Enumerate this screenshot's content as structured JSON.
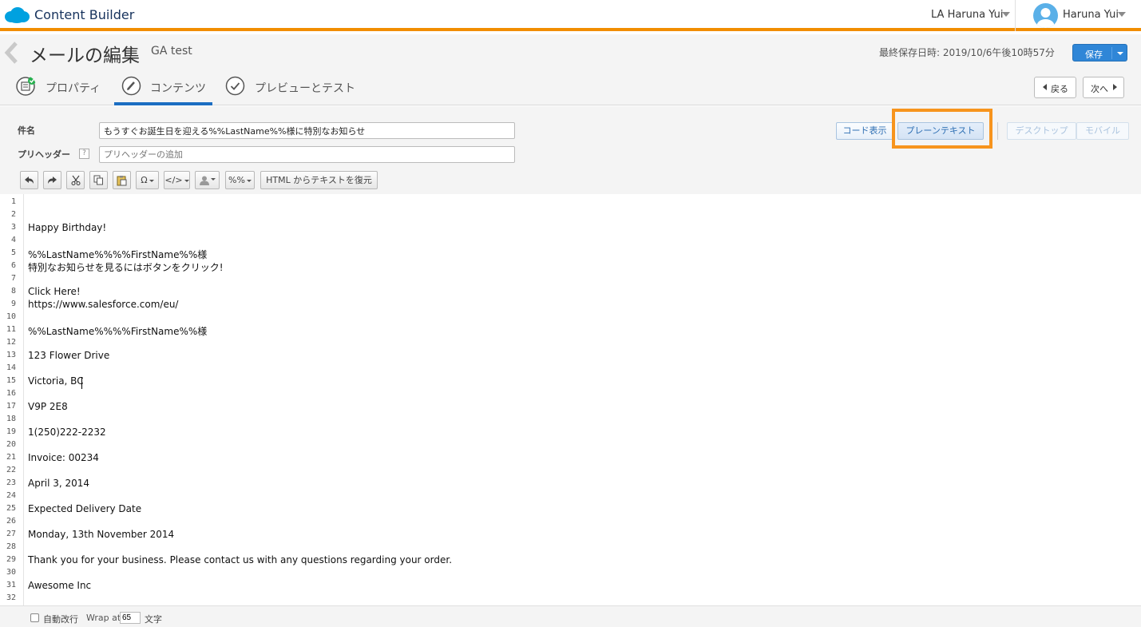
{
  "topbar": {
    "app_title": "Content Builder",
    "account": "LA Haruna Yui",
    "user": "Haruna Yui"
  },
  "header": {
    "title": "メールの編集",
    "email_name": "GA test",
    "saved_at": "最終保存日時: 2019/10/6午後10時57分",
    "save_label": "保存",
    "tabs": [
      {
        "label": "プロパティ",
        "icon": "properties-check-icon"
      },
      {
        "label": "コンテンツ",
        "icon": "pencil-icon",
        "active": true
      },
      {
        "label": "プレビューとテスト",
        "icon": "checkmark-icon"
      }
    ],
    "prev_label": "戻る",
    "next_label": "次へ"
  },
  "form": {
    "subject_label": "件名",
    "subject_value": "もうすぐお誕生日を迎える%%LastName%%様に特別なお知らせ",
    "preheader_label": "プリヘッダー",
    "preheader_placeholder": "プリヘッダーの追加",
    "help": "?"
  },
  "toolbar": {
    "buttons": [
      "undo-icon",
      "redo-icon",
      "cut-icon",
      "copy-icon",
      "paste-icon",
      "special-char-icon",
      "code-icon",
      "personalization-icon",
      "percent-icon"
    ],
    "omega": "Ω",
    "code": "</>",
    "percent": "%%",
    "restore_label": "HTML からテキストを復元"
  },
  "views": {
    "code_view": "コード表示",
    "plain_text": "プレーンテキスト",
    "desktop": "デスクトップ",
    "mobile": "モバイル"
  },
  "editor": {
    "lines": [
      "",
      "",
      "Happy Birthday!",
      "",
      "%%LastName%%%%FirstName%%様",
      "特別なお知らせを見るにはボタンをクリック!",
      "",
      "Click Here!",
      "https://www.salesforce.com/eu/",
      "",
      "%%LastName%%%%FirstName%%様",
      "",
      "123 Flower Drive",
      "",
      "Victoria, BC",
      "",
      "V9P 2E8",
      "",
      "1(250)222-2232",
      "",
      "Invoice: 00234",
      "",
      "April 3, 2014",
      "",
      "Expected Delivery Date",
      "",
      "Monday, 13th November 2014",
      "",
      "Thank you for your business. Please contact us with any questions regarding your order.",
      "",
      "Awesome Inc",
      ""
    ]
  },
  "footer": {
    "autowrap_label": "自動改行",
    "wrap_at": "Wrap at",
    "wrap_value": "65",
    "unit": "文字"
  },
  "colors": {
    "brand_orange": "#f18d00",
    "save_blue": "#2f86d7",
    "highlight": "#f7941d"
  }
}
